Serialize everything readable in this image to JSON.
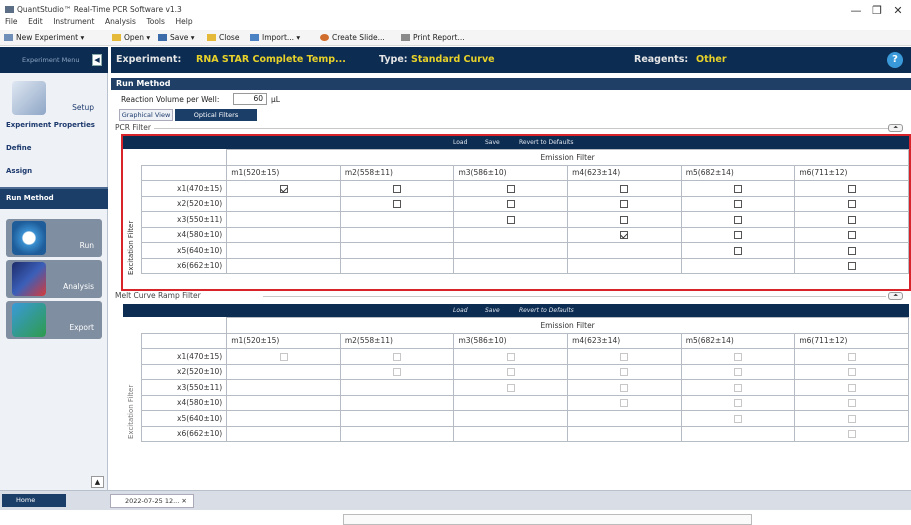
{
  "window": {
    "title": "QuantStudio™ Real-Time PCR Software v1.3",
    "controls": {
      "minimize": "—",
      "maximize": "❐",
      "close": "✕"
    }
  },
  "menu": [
    "File",
    "Edit",
    "Instrument",
    "Analysis",
    "Tools",
    "Help"
  ],
  "toolbar": {
    "new_experiment": "New Experiment ▾",
    "open": "Open ▾",
    "save": "Save ▾",
    "close": "Close",
    "import": "Import... ▾",
    "create_slide": "Create Slide...",
    "print_report": "Print Report..."
  },
  "sidebar": {
    "home_label": "Experiment Menu",
    "setup_label": "Setup",
    "links": [
      "Experiment Properties",
      "Define",
      "Assign",
      "Run Method"
    ],
    "run_label": "Run",
    "analysis_label": "Analysis",
    "export_label": "Export",
    "scroll_up": "▲",
    "collapse": "◀"
  },
  "header": {
    "experiment_label": "Experiment:",
    "experiment_name": "RNA STAR Complete Temp...",
    "type_label": "Type:",
    "type_value": "Standard Curve",
    "reagents_label": "Reagents:",
    "reagents_value": "Other",
    "help": "?"
  },
  "run_method": {
    "title": "Run Method",
    "reaction_volume_label": "Reaction Volume per Well:",
    "reaction_volume_value": "60",
    "reaction_volume_unit": "μL",
    "tabs": [
      "Graphical View",
      "Optical Filters"
    ]
  },
  "pcr_filter": {
    "label": "PCR Filter",
    "actions": [
      "Load",
      "Save",
      "Revert to Defaults"
    ],
    "emission_label": "Emission Filter",
    "excitation_label": "Excitation Filter",
    "columns": [
      "m1(520±15)",
      "m2(558±11)",
      "m3(586±10)",
      "m4(623±14)",
      "m5(682±14)",
      "m6(711±12)"
    ],
    "rows": [
      {
        "label": "x1(470±15)",
        "cells": [
          "checked",
          "box",
          "box",
          "box",
          "box",
          "box"
        ]
      },
      {
        "label": "x2(520±10)",
        "cells": [
          "",
          "box",
          "box",
          "box",
          "box",
          "box"
        ]
      },
      {
        "label": "x3(550±11)",
        "cells": [
          "",
          "",
          "box",
          "box",
          "box",
          "box"
        ]
      },
      {
        "label": "x4(580±10)",
        "cells": [
          "",
          "",
          "",
          "checked",
          "box",
          "box"
        ]
      },
      {
        "label": "x5(640±10)",
        "cells": [
          "",
          "",
          "",
          "",
          "box",
          "box"
        ]
      },
      {
        "label": "x6(662±10)",
        "cells": [
          "",
          "",
          "",
          "",
          "",
          "box"
        ]
      }
    ]
  },
  "melt_filter": {
    "label": "Melt Curve Ramp Filter",
    "actions": [
      "Load",
      "Save",
      "Revert to Defaults"
    ],
    "emission_label": "Emission Filter",
    "excitation_label": "Excitation Filter",
    "columns": [
      "m1(520±15)",
      "m2(558±11)",
      "m3(586±10)",
      "m4(623±14)",
      "m5(682±14)",
      "m6(711±12)"
    ],
    "rows": [
      {
        "label": "x1(470±15)",
        "cells": [
          "dis",
          "dis",
          "dis",
          "dis",
          "dis",
          "dis"
        ]
      },
      {
        "label": "x2(520±10)",
        "cells": [
          "",
          "dis",
          "dis",
          "dis",
          "dis",
          "dis"
        ]
      },
      {
        "label": "x3(550±11)",
        "cells": [
          "",
          "",
          "dis",
          "dis",
          "dis",
          "dis"
        ]
      },
      {
        "label": "x4(580±10)",
        "cells": [
          "",
          "",
          "",
          "dis",
          "dis",
          "dis"
        ]
      },
      {
        "label": "x5(640±10)",
        "cells": [
          "",
          "",
          "",
          "",
          "dis",
          "dis"
        ]
      },
      {
        "label": "x6(662±10)",
        "cells": [
          "",
          "",
          "",
          "",
          "",
          "dis"
        ]
      }
    ]
  },
  "taskbar": {
    "home": "Home",
    "doc_tab": "2022-07-25 12... ✕"
  },
  "colors": {
    "accent_yellow": "#e8d229",
    "navy": "#0c2c52",
    "highlight_red": "#d9232b"
  }
}
